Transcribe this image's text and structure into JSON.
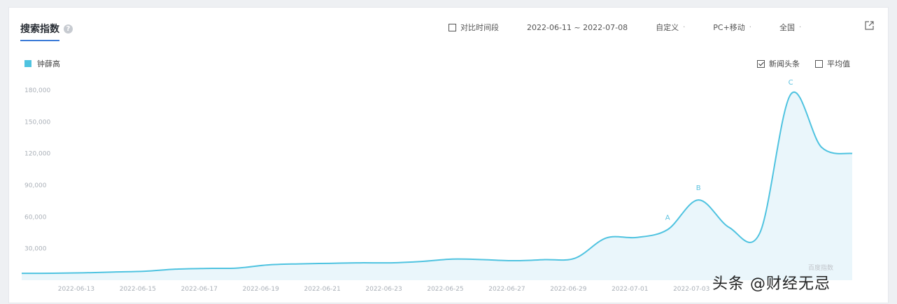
{
  "header": {
    "tab_title": "搜索指数",
    "compare_label": "对比时间段",
    "date_range": "2022-06-11 ~ 2022-07-08",
    "custom_label": "自定义",
    "device_label": "PC+移动",
    "region_label": "全国"
  },
  "legend": {
    "series_label": "钟薛高",
    "color": "#4fc3e0"
  },
  "options": {
    "news_label": "新闻头条",
    "news_checked": true,
    "avg_label": "平均值",
    "avg_checked": false
  },
  "source_mark": "百度指数",
  "watermark": "头条 @财经无忌",
  "chart_data": {
    "type": "area",
    "title": "",
    "xlabel": "",
    "ylabel": "",
    "ylim": [
      0,
      180000
    ],
    "y_ticks": [
      "180,000",
      "150,000",
      "120,000",
      "90,000",
      "60,000",
      "30,000"
    ],
    "x_tick_labels": [
      "2022-06-13",
      "2022-06-15",
      "2022-06-17",
      "2022-06-19",
      "2022-06-21",
      "2022-06-23",
      "2022-06-25",
      "2022-06-27",
      "2022-06-29",
      "2022-07-01",
      "2022-07-03"
    ],
    "x": [
      "2022-06-12",
      "2022-06-13",
      "2022-06-14",
      "2022-06-15",
      "2022-06-16",
      "2022-06-17",
      "2022-06-18",
      "2022-06-19",
      "2022-06-20",
      "2022-06-21",
      "2022-06-22",
      "2022-06-23",
      "2022-06-24",
      "2022-06-25",
      "2022-06-26",
      "2022-06-27",
      "2022-06-28",
      "2022-06-29",
      "2022-06-30",
      "2022-07-01",
      "2022-07-02",
      "2022-07-03",
      "2022-07-04",
      "2022-07-05",
      "2022-07-06",
      "2022-07-07"
    ],
    "series": [
      {
        "name": "钟薛高",
        "values": [
          6500,
          6600,
          7000,
          7800,
          8500,
          10500,
          11200,
          11500,
          14500,
          15500,
          16000,
          16500,
          16500,
          17800,
          20000,
          19500,
          18500,
          19500,
          21000,
          40000,
          40500,
          48000,
          76000,
          50000,
          45000,
          176000,
          126000,
          120000
        ]
      }
    ],
    "annotations": [
      {
        "label": "A",
        "x": "2022-07-01"
      },
      {
        "label": "B",
        "x": "2022-07-03"
      },
      {
        "label": "C",
        "x": "2022-07-06"
      }
    ],
    "grid": false
  }
}
